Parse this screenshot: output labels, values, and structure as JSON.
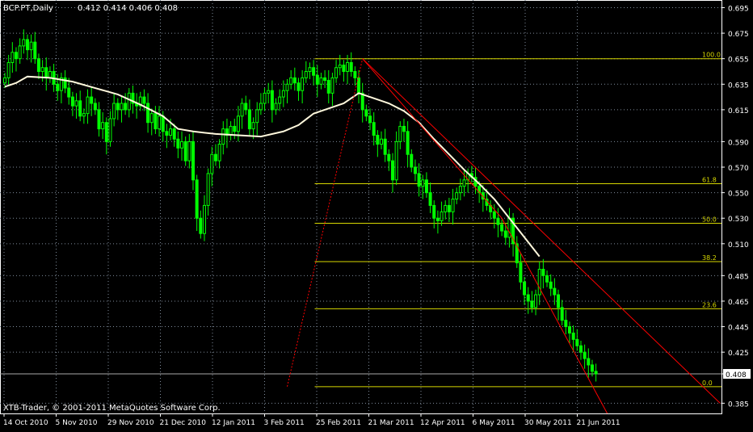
{
  "window": {
    "symbol": "BCP.PT,Daily",
    "ohlc": "0.412 0.414 0.406 0.408",
    "copyright": "XTB-Trader, © 2001-2011 MetaQuotes Software Corp.",
    "current_price": "0.408"
  },
  "colors": {
    "background": "#000000",
    "grid": "#7f8c9b",
    "foreground": "#ffffff",
    "candles": "#00ff00",
    "moving_average": "#fff8dc",
    "fibonacci": "#d7d700",
    "trendline": "#ff0000"
  },
  "chart_data": {
    "type": "line",
    "y_axis_ticks": [
      "0.695",
      "0.675",
      "0.655",
      "0.635",
      "0.615",
      "0.590",
      "0.570",
      "0.550",
      "0.530",
      "0.510",
      "0.485",
      "0.465",
      "0.445",
      "0.425",
      "0.408",
      "0.385"
    ],
    "x_axis_ticks": [
      "14 Oct 2010",
      "5 Nov 2010",
      "29 Nov 2010",
      "21 Dec 2010",
      "12 Jan 2011",
      "3 Feb 2011",
      "25 Feb 2011",
      "21 Mar 2011",
      "12 Apr 2011",
      "6 May 2011",
      "30 May 2011",
      "21 Jun 2011"
    ],
    "ylim": [
      0.377,
      0.701
    ],
    "close": [
      0.64,
      0.652,
      0.66,
      0.655,
      0.665,
      0.67,
      0.662,
      0.668,
      0.655,
      0.645,
      0.648,
      0.64,
      0.645,
      0.635,
      0.63,
      0.64,
      0.632,
      0.625,
      0.618,
      0.622,
      0.61,
      0.612,
      0.625,
      0.62,
      0.615,
      0.6,
      0.605,
      0.59,
      0.608,
      0.62,
      0.615,
      0.62,
      0.615,
      0.628,
      0.62,
      0.618,
      0.625,
      0.62,
      0.605,
      0.612,
      0.6,
      0.61,
      0.598,
      0.595,
      0.6,
      0.592,
      0.585,
      0.59,
      0.575,
      0.59,
      0.56,
      0.53,
      0.518,
      0.54,
      0.565,
      0.58,
      0.575,
      0.588,
      0.6,
      0.595,
      0.602,
      0.598,
      0.61,
      0.62,
      0.615,
      0.6,
      0.605,
      0.615,
      0.62,
      0.628,
      0.63,
      0.615,
      0.62,
      0.625,
      0.63,
      0.635,
      0.64,
      0.636,
      0.63,
      0.64,
      0.645,
      0.648,
      0.642,
      0.635,
      0.64,
      0.638,
      0.628,
      0.64,
      0.648,
      0.65,
      0.645,
      0.652,
      0.645,
      0.64,
      0.628,
      0.615,
      0.61,
      0.605,
      0.595,
      0.588,
      0.592,
      0.58,
      0.575,
      0.56,
      0.59,
      0.602,
      0.598,
      0.58,
      0.57,
      0.565,
      0.555,
      0.56,
      0.55,
      0.54,
      0.53,
      0.528,
      0.535,
      0.54,
      0.535,
      0.545,
      0.55,
      0.555,
      0.56,
      0.565,
      0.562,
      0.555,
      0.55,
      0.545,
      0.54,
      0.535,
      0.53,
      0.525,
      0.52,
      0.515,
      0.53,
      0.51,
      0.495,
      0.48,
      0.47,
      0.465,
      0.46,
      0.47,
      0.49,
      0.485,
      0.48,
      0.475,
      0.47,
      0.46,
      0.45,
      0.445,
      0.44,
      0.435,
      0.43,
      0.425,
      0.42,
      0.415,
      0.41,
      0.408
    ],
    "moving_average": [
      [
        0,
        0.633
      ],
      [
        3,
        0.636
      ],
      [
        6,
        0.641
      ],
      [
        12,
        0.64
      ],
      [
        18,
        0.637
      ],
      [
        24,
        0.632
      ],
      [
        30,
        0.627
      ],
      [
        36,
        0.619
      ],
      [
        42,
        0.61
      ],
      [
        46,
        0.6
      ],
      [
        50,
        0.598
      ],
      [
        56,
        0.596
      ],
      [
        62,
        0.595
      ],
      [
        68,
        0.594
      ],
      [
        74,
        0.598
      ],
      [
        78,
        0.603
      ],
      [
        82,
        0.612
      ],
      [
        86,
        0.616
      ],
      [
        90,
        0.62
      ],
      [
        94,
        0.628
      ],
      [
        98,
        0.624
      ],
      [
        102,
        0.62
      ],
      [
        106,
        0.614
      ],
      [
        110,
        0.605
      ],
      [
        114,
        0.592
      ],
      [
        118,
        0.58
      ],
      [
        122,
        0.568
      ],
      [
        126,
        0.557
      ],
      [
        130,
        0.545
      ],
      [
        134,
        0.53
      ],
      [
        138,
        0.515
      ],
      [
        142,
        0.5
      ]
    ],
    "fibonacci": {
      "start_index": 75,
      "levels": [
        {
          "label": "100.0",
          "price": 0.655
        },
        {
          "label": "61.8",
          "price": 0.557
        },
        {
          "label": "50.0",
          "price": 0.526
        },
        {
          "label": "38.2",
          "price": 0.496
        },
        {
          "label": "23.6",
          "price": 0.459
        },
        {
          "label": "0.0",
          "price": 0.398
        }
      ]
    },
    "trendlines": [
      {
        "style": "dotted",
        "points": [
          [
            75,
            0.398
          ],
          [
            95,
            0.655
          ]
        ]
      },
      {
        "style": "solid",
        "points": [
          [
            95,
            0.655
          ],
          [
            190,
            0.385
          ]
        ]
      },
      {
        "style": "solid",
        "points": [
          [
            95,
            0.655
          ],
          [
            132,
            0.53
          ],
          [
            160,
            0.377
          ]
        ]
      }
    ]
  }
}
